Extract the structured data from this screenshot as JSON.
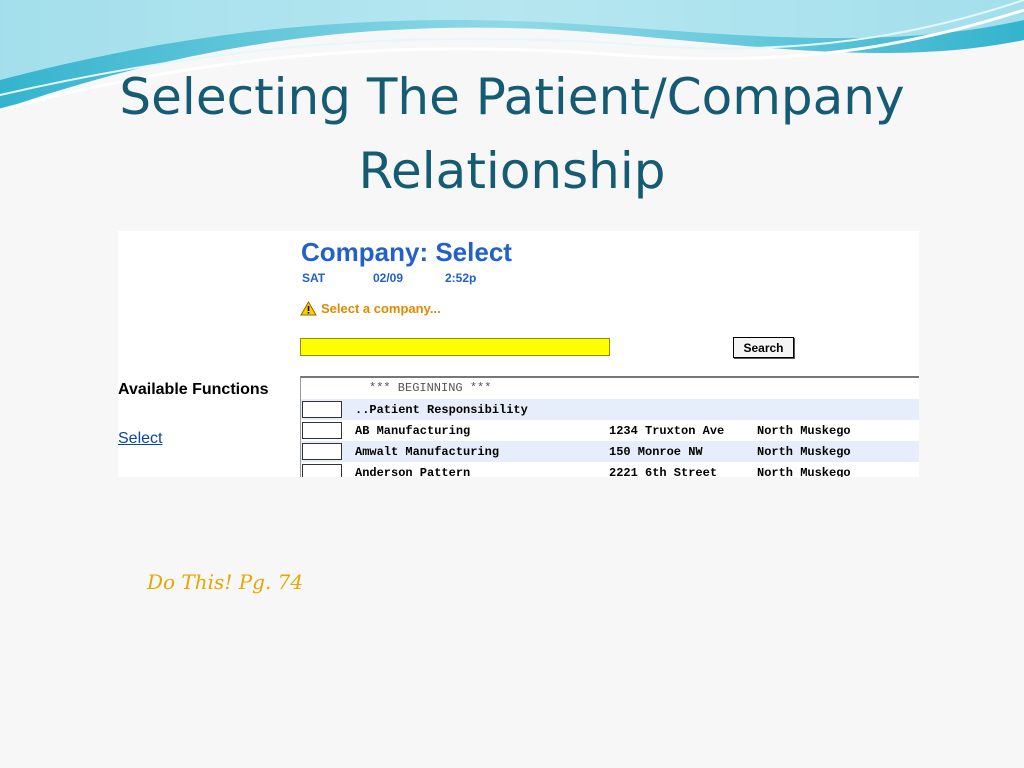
{
  "slide": {
    "title": "Selecting The Patient/Company Relationship",
    "footnote": "Do This! Pg. 74"
  },
  "screen": {
    "heading": "Company: Select",
    "day": "SAT",
    "date": "02/09",
    "time": "2:52p",
    "prompt": "Select a company...",
    "search_value": "",
    "search_button": "Search",
    "left_panel": {
      "heading": "Available Functions",
      "link": "Select"
    },
    "results": {
      "beginning": "*** BEGINNING ***",
      "rows": [
        {
          "name": "..Patient Responsibility",
          "address": "",
          "city": ""
        },
        {
          "name": "AB Manufacturing",
          "address": "1234 Truxton Ave",
          "city": "North Muskego"
        },
        {
          "name": "Amwalt Manufacturing",
          "address": "150 Monroe NW",
          "city": "North Muskego"
        },
        {
          "name": "Anderson Pattern",
          "address": "2221 6th Street",
          "city": "North Muskego"
        }
      ]
    }
  },
  "colors": {
    "title": "#155b73",
    "heading": "#2360c7",
    "warning": "#e08a00",
    "input_bg": "#ffff00",
    "footnote": "#e8a600"
  },
  "icons": {
    "prompt": "warning-icon"
  }
}
